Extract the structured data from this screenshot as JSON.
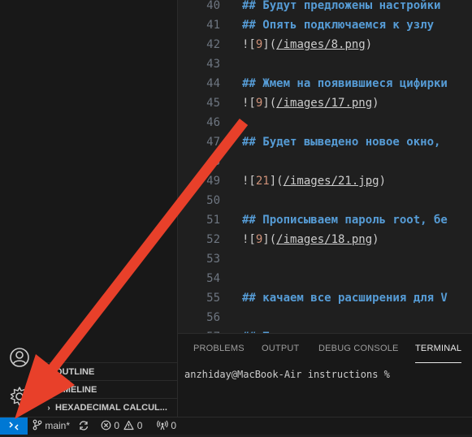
{
  "editor": {
    "lines": [
      {
        "n": "40",
        "kind": "hdr",
        "text": "## Будут предложены настройки"
      },
      {
        "n": "41",
        "kind": "hdr",
        "text": "## Опять подключаемся к узлу"
      },
      {
        "n": "42",
        "kind": "img",
        "alt": "9",
        "path": "/images/8.png"
      },
      {
        "n": "43",
        "kind": "empty",
        "text": ""
      },
      {
        "n": "44",
        "kind": "hdr",
        "text": "## Жмем на появившиеся цифирки"
      },
      {
        "n": "45",
        "kind": "img",
        "alt": "9",
        "path": "/images/17.png"
      },
      {
        "n": "46",
        "kind": "empty",
        "text": ""
      },
      {
        "n": "47",
        "kind": "hdr",
        "text": "## Будет выведено новое окно,"
      },
      {
        "n": "48",
        "kind": "empty",
        "text": ""
      },
      {
        "n": "49",
        "kind": "img",
        "alt": "21",
        "path": "/images/21.jpg"
      },
      {
        "n": "50",
        "kind": "empty",
        "text": ""
      },
      {
        "n": "51",
        "kind": "hdr",
        "text": "## Прописываем пароль root, бе"
      },
      {
        "n": "52",
        "kind": "img",
        "alt": "9",
        "path": "/images/18.png"
      },
      {
        "n": "53",
        "kind": "empty",
        "text": ""
      },
      {
        "n": "54",
        "kind": "empty",
        "text": ""
      },
      {
        "n": "55",
        "kind": "hdr",
        "text": "## качаем все расширения для V"
      },
      {
        "n": "56",
        "kind": "empty",
        "text": ""
      },
      {
        "n": "57",
        "kind": "hdr",
        "text": "## Т"
      }
    ]
  },
  "panel": {
    "tabs": [
      "PROBLEMS",
      "OUTPUT",
      "DEBUG CONSOLE",
      "TERMINAL"
    ],
    "active_tab": "TERMINAL",
    "terminal_prompt": "anzhiday@MacBook-Air instructions %"
  },
  "sidebar": {
    "sections": [
      "OUTLINE",
      "TIMELINE",
      "HEXADECIMAL CALCUL..."
    ]
  },
  "statusbar": {
    "branch": "main*",
    "errors": "0",
    "warnings": "0",
    "ports": "0"
  },
  "colors": {
    "accent": "#0078d4",
    "arrow": "#e8402a",
    "heading": "#569cd6",
    "alt_number": "#ce9178"
  },
  "icons": [
    "account-icon",
    "settings-gear-icon",
    "remote-icon",
    "source-control-branch-icon",
    "sync-icon",
    "error-icon",
    "warning-icon",
    "broadcast-icon"
  ]
}
